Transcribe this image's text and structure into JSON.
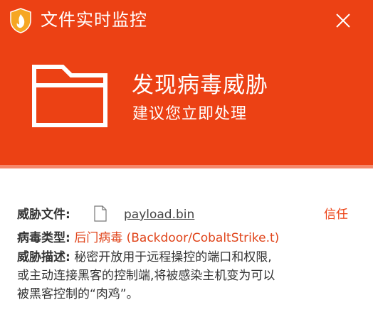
{
  "window": {
    "title": "文件实时监控",
    "close_icon": "close-icon",
    "logo_icon": "shield-flame-icon"
  },
  "alert": {
    "title": "发现病毒威胁",
    "subtitle": "建议您立即处理",
    "icon": "folder-icon"
  },
  "details": {
    "file_label": "威胁文件:",
    "file_name": "payload.bin",
    "file_icon": "file-icon",
    "trust_label": "信任",
    "type_label": "病毒类型:",
    "type_value": "后门病毒 (Backdoor/CobaltStrike.t)",
    "desc_label": "威胁描述:",
    "desc_line1": "秘密开放用于远程操控的端口和权限,",
    "desc_line2": "或主动连接黑客的控制端,将被感染主机变为可以",
    "desc_line3": "被黑客控制的“肉鸡”。"
  },
  "colors": {
    "header": "#ec4114",
    "stripe": "#f5876a",
    "accent_text": "#e0441a"
  }
}
